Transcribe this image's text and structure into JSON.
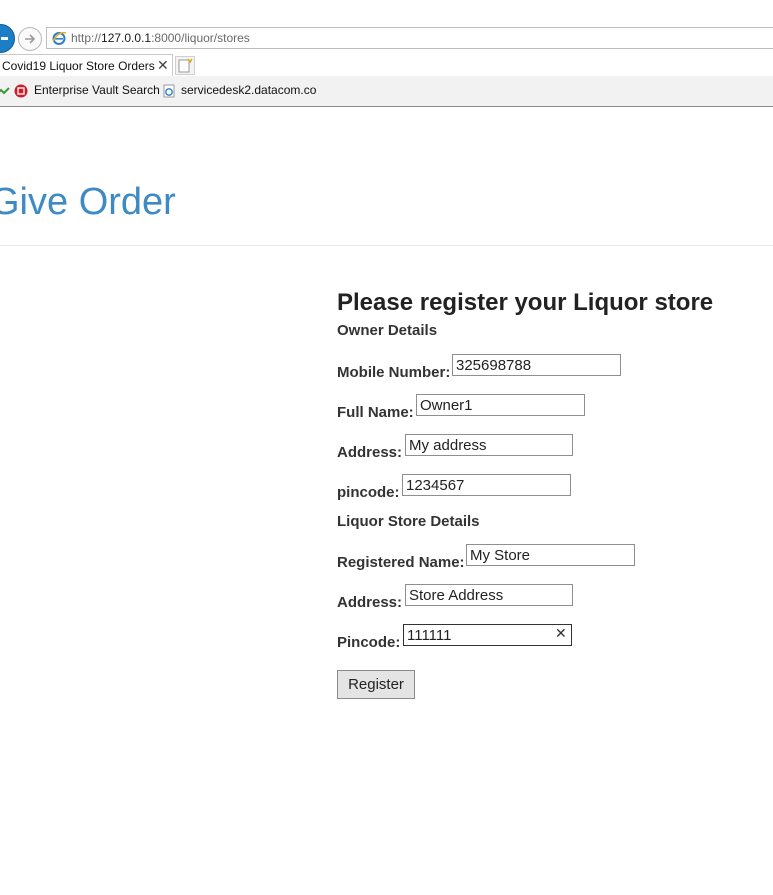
{
  "browser": {
    "url_prefix": "http://",
    "url_host": "127.0.0.1",
    "url_rest": ":8000/liquor/stores",
    "tab_title": "Covid19 Liquor Store Orders",
    "tab_close": "✕",
    "favorites": [
      {
        "label": "Enterprise Vault Search"
      },
      {
        "label": "servicedesk2.datacom.co"
      }
    ]
  },
  "page": {
    "heading": "Give Order",
    "form_title": "Please register your Liquor store",
    "owner_section": "Owner Details",
    "store_section": "Liquor Store Details",
    "fields": {
      "mobile": {
        "label": "Mobile Number:",
        "value": "325698788"
      },
      "full_name": {
        "label": "Full Name:",
        "value": "Owner1"
      },
      "owner_address": {
        "label": "Address:",
        "value": "My address"
      },
      "owner_pincode": {
        "label": "pincode:",
        "value": "1234567"
      },
      "registered_name": {
        "label": "Registered Name:",
        "value": "My Store"
      },
      "store_address": {
        "label": "Address:",
        "value": "Store Address"
      },
      "store_pincode": {
        "label": "Pincode:",
        "value": "111111",
        "clear": "✕"
      }
    },
    "register_label": "Register"
  },
  "colors": {
    "heading": "#3d8ac4",
    "back_button": "#1b7ec6"
  },
  "icons": {
    "back": "back-arrow-icon",
    "forward": "forward-arrow-icon",
    "page": "ie-page-icon",
    "new_tab": "new-tab-icon",
    "favorites": "favorites-icon",
    "vault": "enterprise-vault-icon"
  }
}
